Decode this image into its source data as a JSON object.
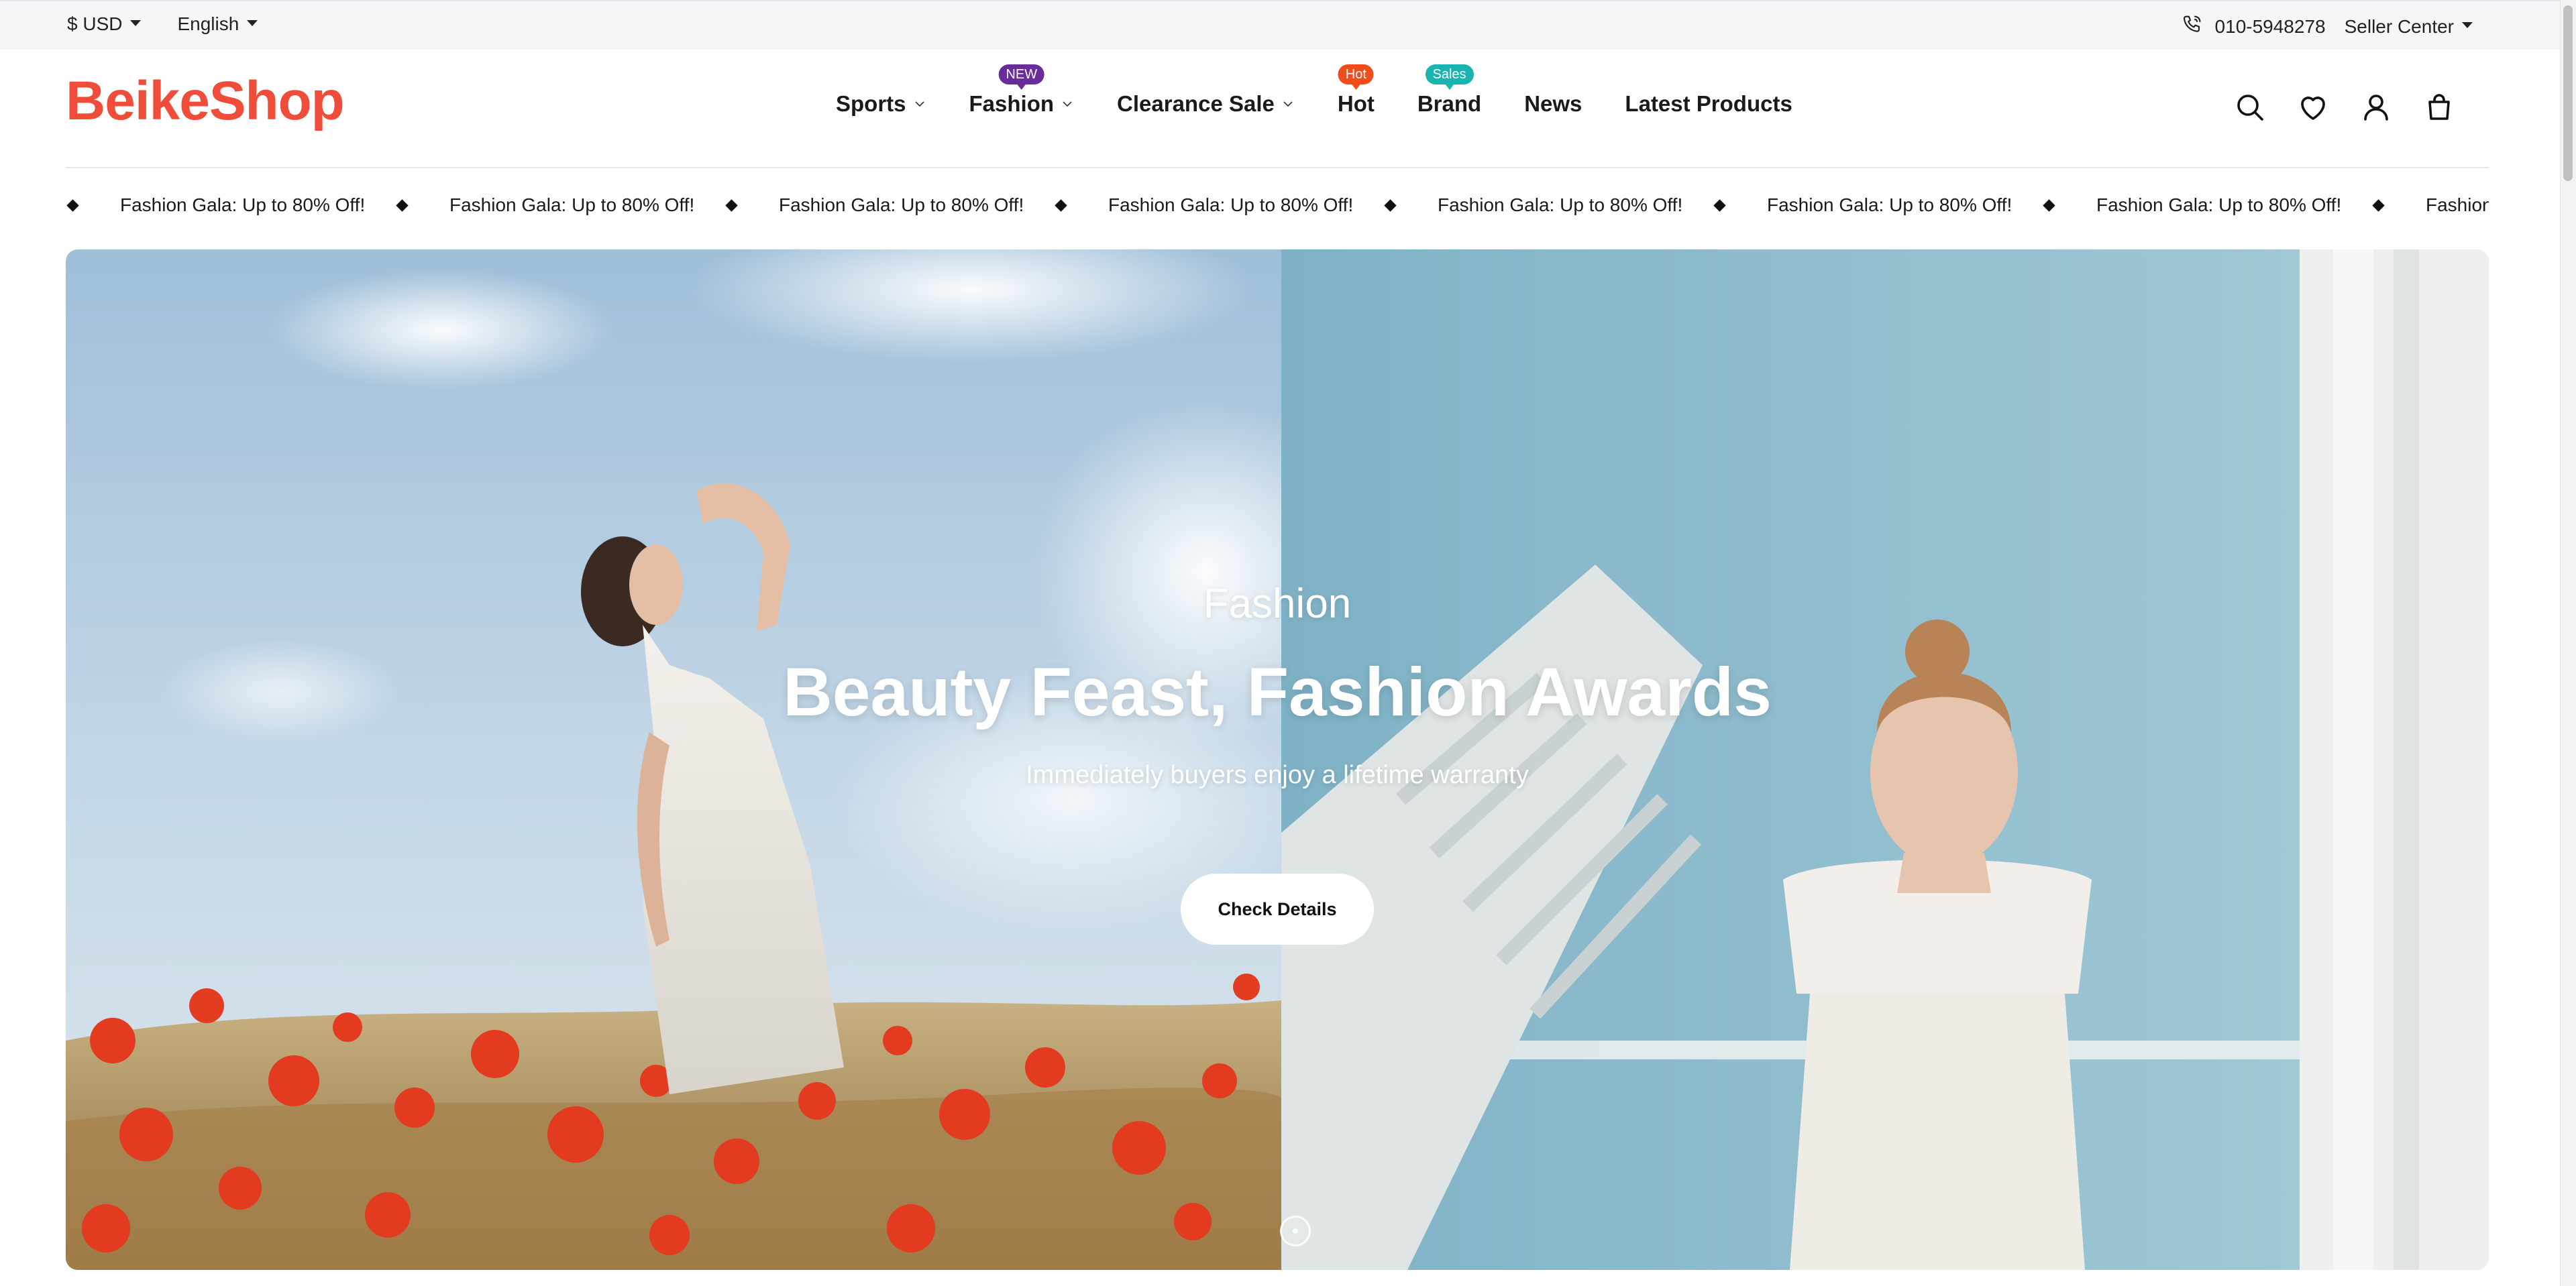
{
  "topbar": {
    "currency": "$ USD",
    "language": "English",
    "phone": "010-5948278",
    "seller_center": "Seller Center"
  },
  "brand": {
    "logo_text": "BeikeShop",
    "color": "#ef4d3a"
  },
  "nav": {
    "items": [
      {
        "label": "Sports",
        "badge": ""
      },
      {
        "label": "Fashion",
        "badge": "NEW"
      },
      {
        "label": "Clearance Sale",
        "badge": ""
      },
      {
        "label": "Hot",
        "badge": "Hot"
      },
      {
        "label": "Brand",
        "badge": "Sales"
      },
      {
        "label": "News",
        "badge": ""
      },
      {
        "label": "Latest Products",
        "badge": ""
      }
    ],
    "badge_colors": {
      "new": "#6a2c9b",
      "hot": "#f04c1c",
      "sales": "#19b3b0"
    }
  },
  "header_icons": [
    "search-icon",
    "heart-icon",
    "user-icon",
    "shopping-bag-icon"
  ],
  "ticker": {
    "text": "Fashion Gala: Up to 80% Off!"
  },
  "hero": {
    "subtitle": "Fashion",
    "title": "Beauty Feast, Fashion Awards",
    "description": "Immediately buyers enjoy a lifetime warranty",
    "button_label": "Check Details"
  }
}
